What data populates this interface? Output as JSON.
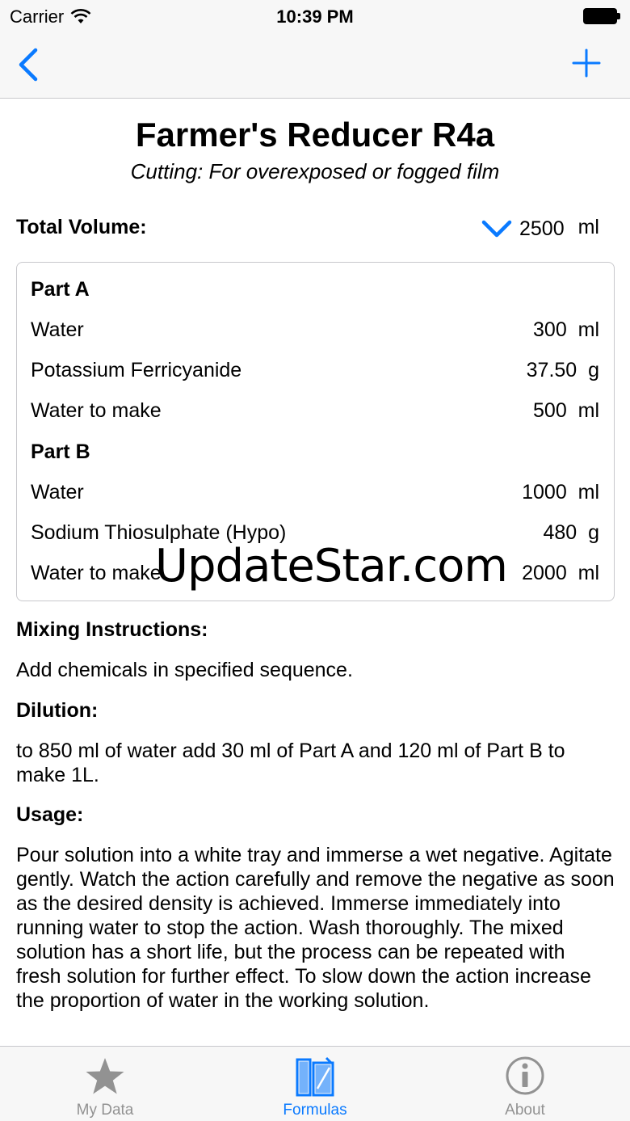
{
  "status_bar": {
    "carrier": "Carrier",
    "time": "10:39 PM"
  },
  "nav": {
    "back_icon": "chevron-left-icon",
    "add_icon": "plus-icon",
    "accent_color": "#0a7aff"
  },
  "formula": {
    "title": "Farmer's Reducer R4a",
    "subtitle": "Cutting: For overexposed or fogged film",
    "total_volume_label": "Total Volume:",
    "total_volume_value": "2500",
    "total_volume_unit": "ml"
  },
  "recipe": {
    "rows": [
      {
        "name": "Part A",
        "amount": "",
        "header": true
      },
      {
        "name": "Water",
        "amount": "300  ml"
      },
      {
        "name": "Potassium Ferricyanide",
        "amount": "37.50  g"
      },
      {
        "name": "Water to make",
        "amount": "500  ml"
      },
      {
        "name": "Part B",
        "amount": "",
        "header": true
      },
      {
        "name": "Water",
        "amount": "1000  ml"
      },
      {
        "name": "Sodium Thiosulphate (Hypo)",
        "amount": "480  g"
      },
      {
        "name": "Water to make",
        "amount": "2000  ml"
      }
    ]
  },
  "watermark": "UpdateStar.com",
  "mixing": {
    "label": "Mixing Instructions:",
    "text": "Add chemicals in specified sequence."
  },
  "dilution": {
    "label": "Dilution:",
    "text": "to 850 ml of water add 30 ml of Part A and 120 ml of Part B to make 1L."
  },
  "usage": {
    "label": "Usage:",
    "text": "Pour solution into a white tray and immerse a wet negative. Agitate gently. Watch the action carefully and remove the negative as soon as the desired density is achieved. Immerse immediately into running water to stop the action. Wash thoroughly. The mixed solution has a short life, but the process can be repeated with fresh solution for further effect. To slow down the action increase the proportion of water in the working solution."
  },
  "tabs": [
    {
      "label": "My Data",
      "icon": "star-icon",
      "active": false
    },
    {
      "label": "Formulas",
      "icon": "formulas-icon",
      "active": true
    },
    {
      "label": "About",
      "icon": "info-icon",
      "active": false
    }
  ]
}
